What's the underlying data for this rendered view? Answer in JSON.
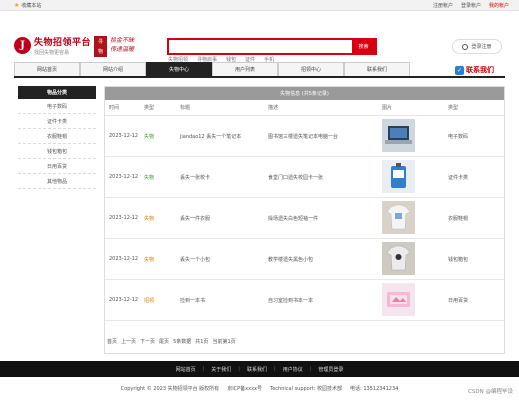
{
  "topbar": {
    "favorite": "收藏本站",
    "links": [
      "注册帐户",
      "登录帐户",
      "我的帐户"
    ]
  },
  "header": {
    "logo_mark": "J",
    "site_title": "失物招领平台",
    "site_sub": "找回失物更容易",
    "seal_text": [
      "寻",
      "物"
    ],
    "slogan_line1": "拾金不昧",
    "slogan_line2": "传递温暖",
    "search": {
      "placeholder": "",
      "button": "搜索"
    },
    "hot_words": [
      "失物招领",
      "寻物启事",
      "钱包",
      "证件",
      "手机"
    ],
    "login_label": "登录注册"
  },
  "nav": {
    "tabs": [
      "网站首页",
      "网站介绍",
      "失物中心",
      "用户列表",
      "招领中心",
      "联系我们"
    ],
    "active_index": 2,
    "contact": "联系我们"
  },
  "sidebar": {
    "title": "物品分类",
    "items": [
      "电子数码",
      "证件卡类",
      "衣服鞋帽",
      "钱包箱包",
      "日用百货",
      "其他物品"
    ]
  },
  "table": {
    "title": "失物信息 (共5条记录)",
    "headers": [
      "时间",
      "类型",
      "标题",
      "描述",
      "图片",
      "类型"
    ],
    "rows": [
      {
        "date": "2023-12-12",
        "type": "失物",
        "type_color": "green",
        "title": "jiandao12 丢失一个笔记本",
        "desc": "图书馆三楼遗失笔记本电脑一台",
        "img": "laptop",
        "category": "电子数码"
      },
      {
        "date": "2023-12-12",
        "type": "失物",
        "type_color": "green",
        "title": "丢失一张校卡",
        "desc": "食堂门口遗失校园卡一张",
        "img": "card",
        "category": "证件卡类"
      },
      {
        "date": "2023-12-12",
        "type": "失物",
        "type_color": "orange",
        "title": "丢失一件衣服",
        "desc": "操场遗失白色短袖一件",
        "img": "tshirt1",
        "category": "衣服鞋帽"
      },
      {
        "date": "2023-12-12",
        "type": "失物",
        "type_color": "orange",
        "title": "丢失一个小包",
        "desc": "教学楼遗失黑色小包",
        "img": "tshirt2",
        "category": "钱包箱包"
      },
      {
        "date": "2023-12-12",
        "type": "招领",
        "type_color": "orange",
        "title": "捡到一本书",
        "desc": "自习室捡到书本一本",
        "img": "book",
        "category": "日用百货"
      }
    ],
    "pager": [
      "首页",
      "上一页",
      "下一页",
      "尾页",
      "5条数据",
      "共1页",
      "当前第1页"
    ]
  },
  "footer": {
    "links": [
      "网站首页",
      "关于我们",
      "联系我们",
      "用户协议",
      "管理员登录"
    ],
    "copyright": [
      "Copyright © 2023 失物招领平台 版权所有",
      "京ICP备xxxx号",
      "Technical support: 校园技术部",
      "电话: 13512341234"
    ],
    "watermark": "CSDN @编程毕设"
  },
  "colors": {
    "brand_red": "#d8000f",
    "nav_active": "#222222",
    "type_green": "#3a9b2f",
    "type_orange": "#e07b00"
  }
}
